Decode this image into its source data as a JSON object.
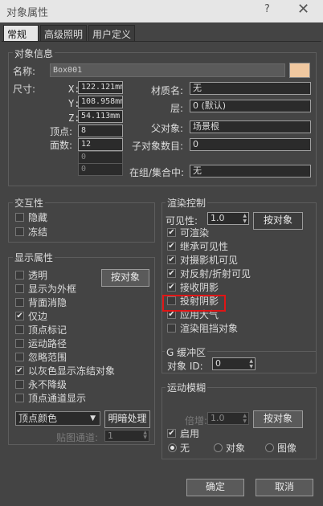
{
  "window": {
    "title": "对象属性",
    "help": "?",
    "close": "✕"
  },
  "tabs": [
    {
      "label": "常规"
    },
    {
      "label": "高级照明"
    },
    {
      "label": "用户定义"
    }
  ],
  "object_info": {
    "title": "对象信息",
    "name_label": "名称:",
    "name_value": "Box001",
    "color_swatch": "#f0c8a0",
    "size_label": "尺寸:",
    "x_label": "X:",
    "x_value": "122.121mm",
    "y_label": "Y:",
    "y_value": "108.958mm",
    "z_label": "Z:",
    "z_value": "54.113mm",
    "vertices_label": "顶点:",
    "vertices_value": "8",
    "faces_label": "面数:",
    "faces_value": "12",
    "extra1_value": "0",
    "extra2_value": "0",
    "material_label": "材质名:",
    "material_value": "无",
    "layer_label": "层:",
    "layer_value": "0 (默认)",
    "parent_label": "父对象:",
    "parent_value": "场景根",
    "children_label": "子对象数目:",
    "children_value": "0",
    "group_label": "在组/集合中:",
    "group_value": "无"
  },
  "interaction": {
    "title": "交互性",
    "hide": {
      "label": "隐藏",
      "checked": false
    },
    "freeze": {
      "label": "冻结",
      "checked": false
    }
  },
  "display": {
    "title": "显示属性",
    "by_object_button": "按对象",
    "items": [
      {
        "label": "透明",
        "checked": false
      },
      {
        "label": "显示为外框",
        "checked": false
      },
      {
        "label": "背面消隐",
        "checked": false
      },
      {
        "label": "仅边",
        "checked": true
      },
      {
        "label": "顶点标记",
        "checked": false
      },
      {
        "label": "运动路径",
        "checked": false
      },
      {
        "label": "忽略范围",
        "checked": false
      },
      {
        "label": "以灰色显示冻结对象",
        "checked": true
      },
      {
        "label": "永不降级",
        "checked": false
      },
      {
        "label": "顶点通道显示",
        "checked": false
      }
    ],
    "vertex_color_dropdown": "顶点颜色",
    "shaded_button": "明暗处理",
    "map_channel_label": "贴图通道:",
    "map_channel_value": "1"
  },
  "render": {
    "title": "渲染控制",
    "visibility_label": "可见性:",
    "visibility_value": "1.0",
    "by_object_button": "按对象",
    "items": [
      {
        "label": "可渲染",
        "checked": true
      },
      {
        "label": "继承可见性",
        "checked": true
      },
      {
        "label": "对摄影机可见",
        "checked": true
      },
      {
        "label": "对反射/折射可见",
        "checked": true
      },
      {
        "label": "接收阴影",
        "checked": true
      },
      {
        "label": "投射阴影",
        "checked": false
      },
      {
        "label": "应用大气",
        "checked": true
      },
      {
        "label": "渲染阻挡对象",
        "checked": false
      }
    ],
    "gbuffer_title": "G 缓冲区",
    "object_id_label": "对象 ID:",
    "object_id_value": "0"
  },
  "motion_blur": {
    "title": "运动模糊",
    "multiplier_label": "倍增:",
    "multiplier_value": "1.0",
    "by_object_button": "按对象",
    "enable": {
      "label": "启用",
      "checked": true
    },
    "radios": [
      {
        "label": "无",
        "selected": true
      },
      {
        "label": "对象",
        "selected": false
      },
      {
        "label": "图像",
        "selected": false
      }
    ]
  },
  "footer": {
    "ok": "确定",
    "cancel": "取消"
  }
}
